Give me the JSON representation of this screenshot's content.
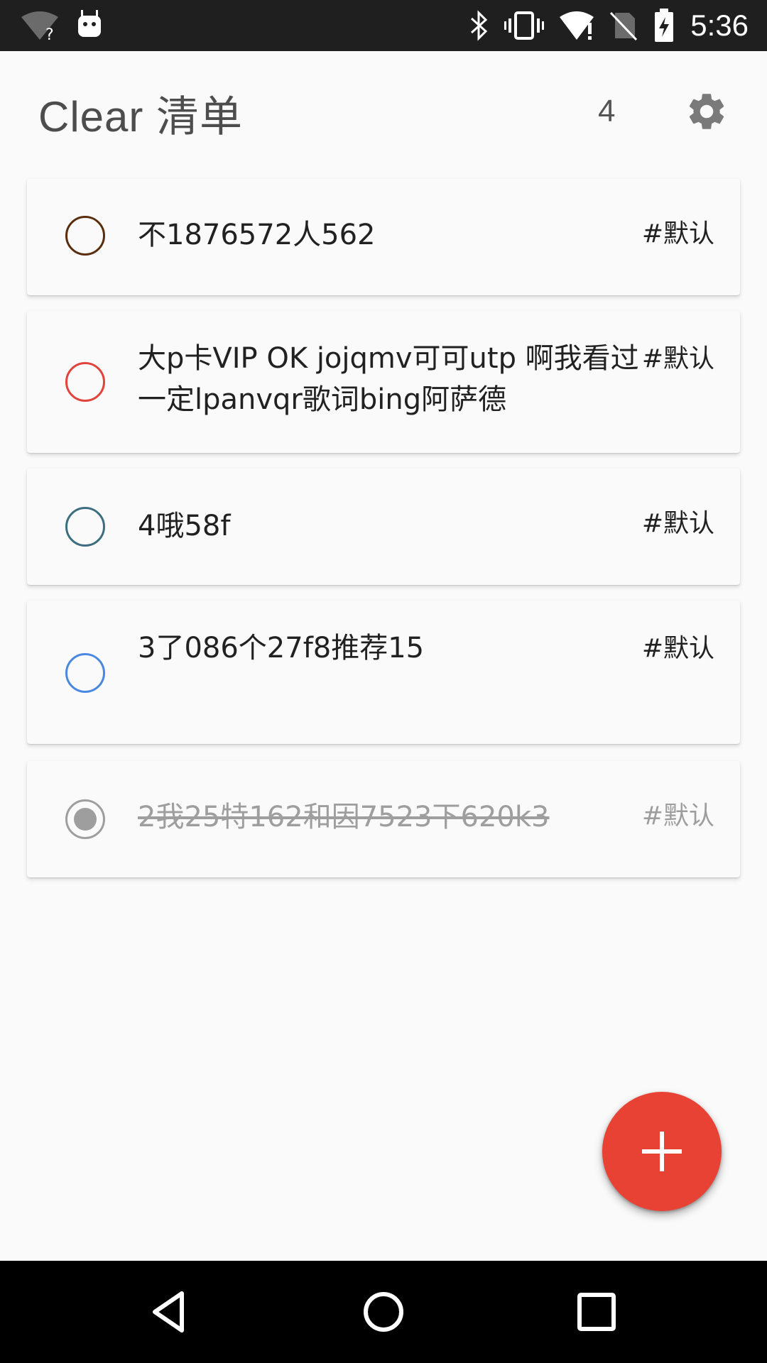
{
  "status_bar": {
    "time": "5:36",
    "icons": [
      "wifi-unknown-icon",
      "android-debug-icon",
      "bluetooth-icon",
      "vibrate-icon",
      "wifi-alert-icon",
      "no-sim-icon",
      "battery-charging-icon"
    ]
  },
  "header": {
    "title": "Clear 清单",
    "count": "4",
    "settings_icon": "gear-icon"
  },
  "tasks": [
    {
      "text": "不1876572人562",
      "tag": "#默认",
      "ring_color": "#5a2d0c",
      "done": false
    },
    {
      "text": "大p卡VIP OK jojqmv可可utp 啊我看过一定lpanvqr歌词bing阿萨德",
      "tag": "#默认",
      "ring_color": "#e2433a",
      "done": false
    },
    {
      "text": "4哦58f",
      "tag": "#默认",
      "ring_color": "#3c6e80",
      "done": false
    },
    {
      "text": "3了086个27f8推荐15",
      "tag": "#默认",
      "ring_color": "#4a88e0",
      "done": false
    },
    {
      "text": "2我25特162和因7523下620k3",
      "tag": "#默认",
      "ring_color": "#9e9e9e",
      "done": true
    }
  ],
  "fab": {
    "icon": "plus-icon",
    "color": "#e84234"
  },
  "nav_bar": {
    "icons": [
      "back-icon",
      "home-icon",
      "recents-icon"
    ]
  }
}
